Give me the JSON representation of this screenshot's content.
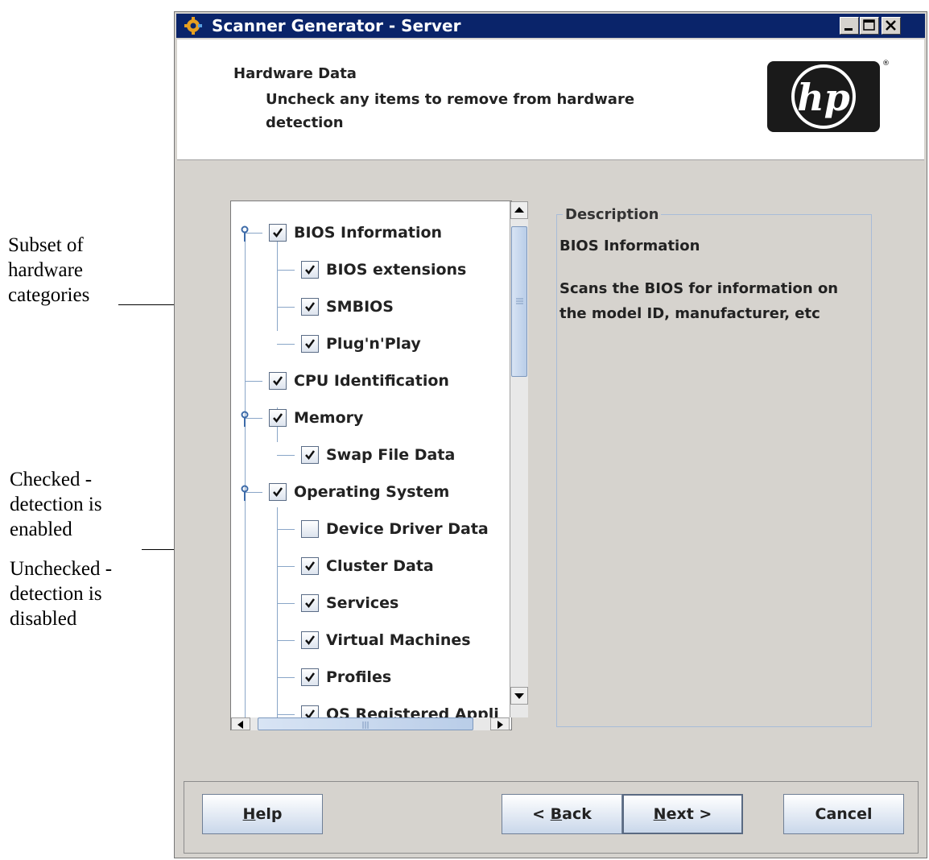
{
  "annotations": {
    "subset": "Subset of\nhardware\ncategories",
    "checked": "Checked -\ndetection is\nenabled",
    "unchecked": "Unchecked -\ndetection is\ndisabled"
  },
  "window": {
    "title": "Scanner Generator - Server"
  },
  "header": {
    "title": "Hardware Data",
    "subtitle": "Uncheck any items to remove from hardware detection",
    "logo_text": "hp",
    "logo_mark": "®"
  },
  "tree": {
    "items": [
      {
        "label": "BIOS Information",
        "checked": true,
        "level": 0,
        "expandable": true
      },
      {
        "label": "BIOS extensions",
        "checked": true,
        "level": 1
      },
      {
        "label": "SMBIOS",
        "checked": true,
        "level": 1
      },
      {
        "label": "Plug'n'Play",
        "checked": true,
        "level": 1
      },
      {
        "label": "CPU Identification",
        "checked": true,
        "level": 0
      },
      {
        "label": "Memory",
        "checked": true,
        "level": 0,
        "expandable": true
      },
      {
        "label": "Swap File Data",
        "checked": true,
        "level": 1
      },
      {
        "label": "Operating System",
        "checked": true,
        "level": 0,
        "expandable": true
      },
      {
        "label": "Device Driver Data",
        "checked": false,
        "level": 1
      },
      {
        "label": "Cluster Data",
        "checked": true,
        "level": 1
      },
      {
        "label": "Services",
        "checked": true,
        "level": 1
      },
      {
        "label": "Virtual Machines",
        "checked": true,
        "level": 1
      },
      {
        "label": "Profiles",
        "checked": true,
        "level": 1
      },
      {
        "label": "OS Registered Appli",
        "checked": true,
        "level": 1
      }
    ]
  },
  "description": {
    "legend": "Description",
    "title": "BIOS Information",
    "text": "Scans the BIOS for information on the model ID, manufacturer, etc"
  },
  "buttons": {
    "help": {
      "mnemonic": "H",
      "rest": "elp"
    },
    "back": {
      "prefix": "< ",
      "mnemonic": "B",
      "rest": "ack"
    },
    "next": {
      "mnemonic": "N",
      "rest": "ext >"
    },
    "cancel": "Cancel"
  }
}
